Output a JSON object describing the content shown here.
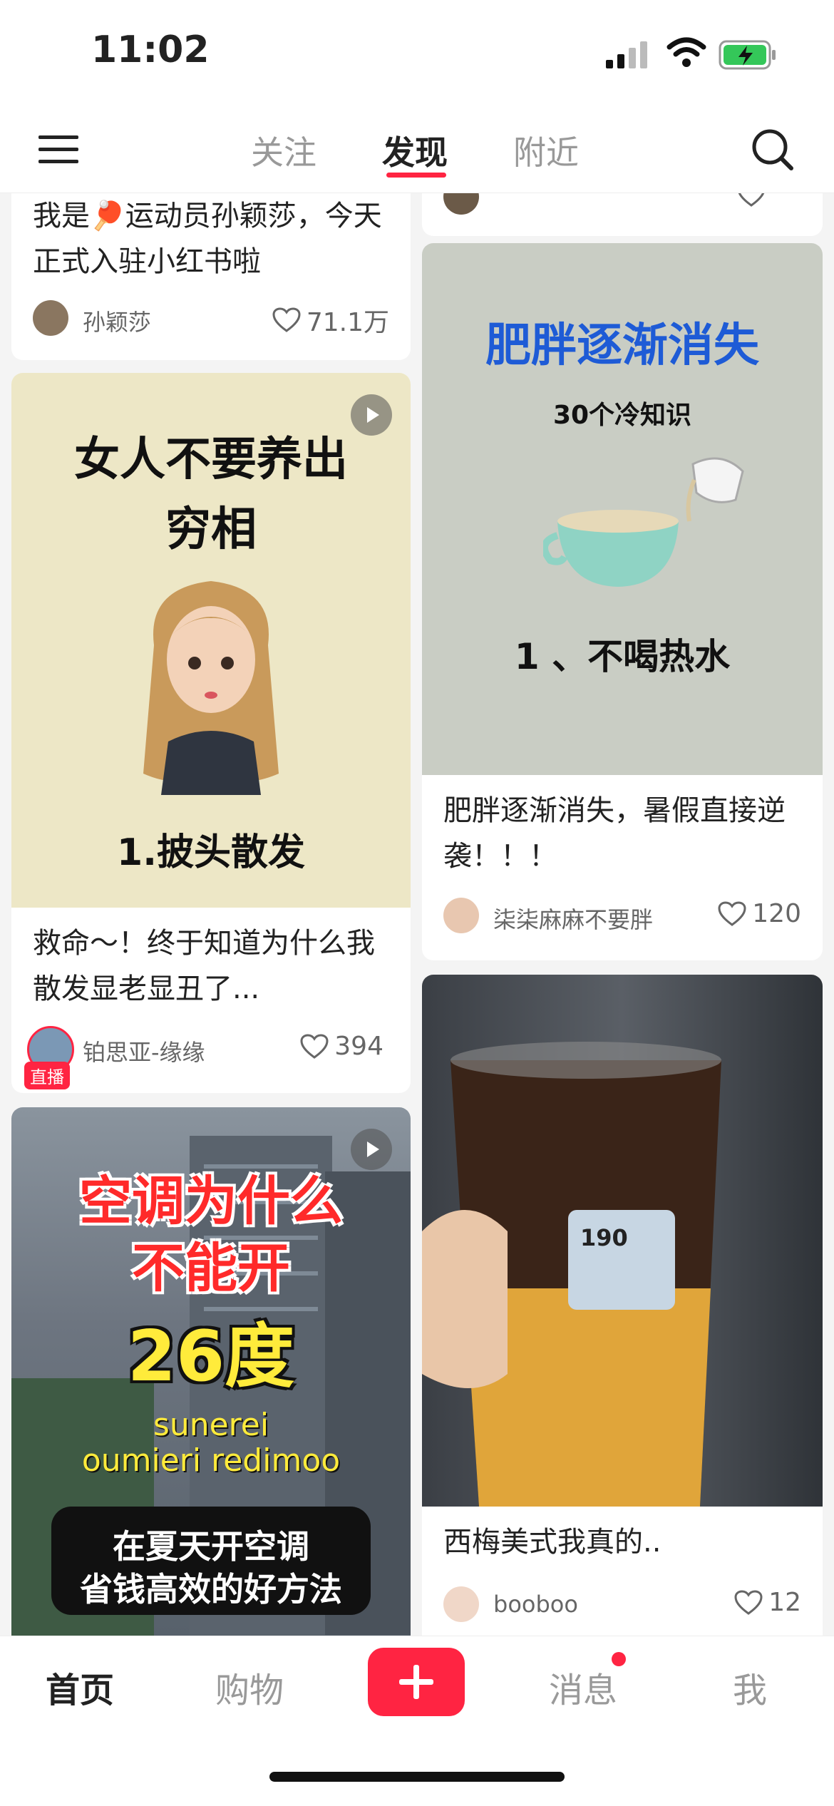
{
  "status_bar": {
    "time": "11:02"
  },
  "top_nav": {
    "tabs": [
      {
        "label": "关注",
        "active": false
      },
      {
        "label": "发现",
        "active": true
      },
      {
        "label": "附近",
        "active": false
      }
    ]
  },
  "feed": {
    "left": [
      {
        "title": "我是🏓运动员孙颖莎，今天正式入驻小红书啦",
        "author": "孙颖莎",
        "likes": "71.1万"
      },
      {
        "cover_text": [
          "女人不要养出",
          "穷相",
          "1.披头散发"
        ],
        "title": "救命～！终于知道为什么我散发显老显丑了...",
        "author": "铂思亚-缘缘",
        "live_label": "直播",
        "likes": "394"
      },
      {
        "cover_text": [
          "空调为什么",
          "不能开",
          "26度",
          "sunerei",
          "oumieri redimoo",
          "在夏天开空调",
          "省钱高效的好方法"
        ]
      }
    ],
    "right": [
      {
        "cover_text": [
          "肥胖逐渐消失",
          "30个冷知识",
          "1 、不喝热水"
        ],
        "title": "肥胖逐渐消失，暑假直接逆袭！！！",
        "author": "柒柒麻麻不要胖",
        "likes": "120"
      },
      {
        "cover_text": [
          "190"
        ],
        "title": "西梅美式我真的..",
        "author": "booboo",
        "likes": "12"
      }
    ]
  },
  "bottom_nav": {
    "items": [
      {
        "label": "首页",
        "active": true
      },
      {
        "label": "购物",
        "active": false
      },
      {
        "label": "消息",
        "active": false
      },
      {
        "label": "我",
        "active": false
      }
    ]
  },
  "colors": {
    "accent": "#ff2442",
    "cover_green": "#c9cdc4",
    "cover_beige": "#ede7c6"
  }
}
